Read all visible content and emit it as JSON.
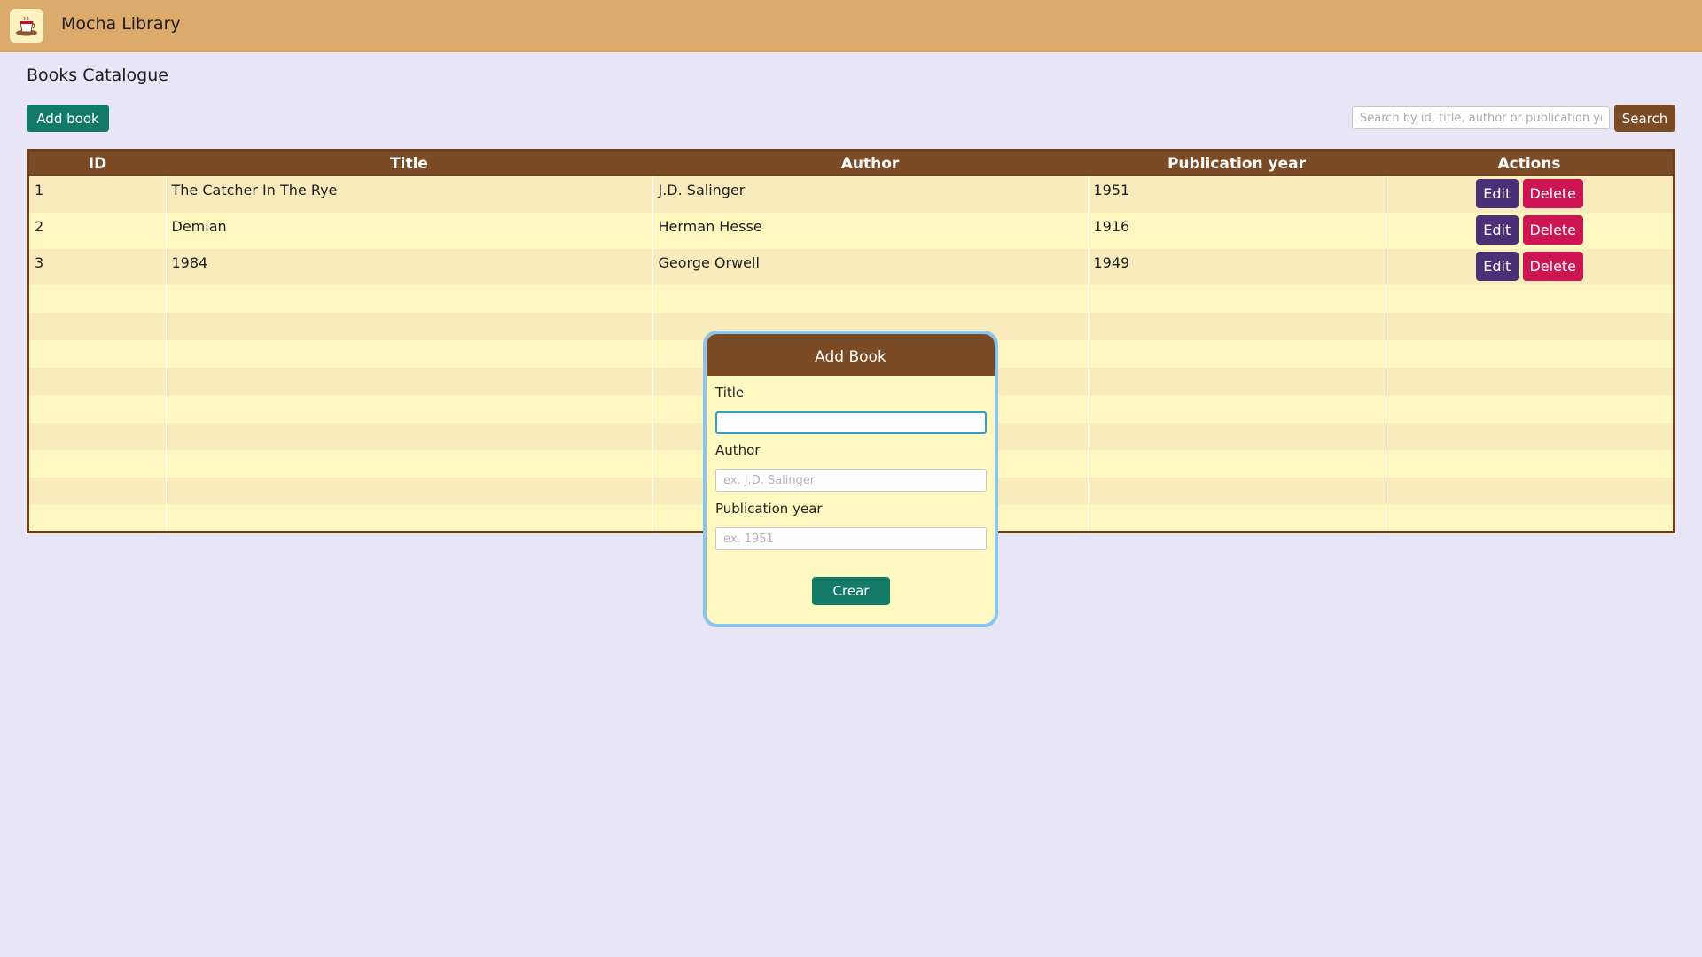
{
  "app": {
    "title": "Mocha Library",
    "logo_icon": "coffee-cup-icon"
  },
  "page": {
    "title": "Books Catalogue",
    "add_label": "Add book"
  },
  "search": {
    "placeholder": "Search by id, title, author or publication year...",
    "value": "",
    "button_label": "Search"
  },
  "table": {
    "headers": [
      "ID",
      "Title",
      "Author",
      "Publication year",
      "Actions"
    ],
    "rows": [
      {
        "id": "1",
        "title": "The Catcher In The Rye",
        "author": "J.D. Salinger",
        "year": "1951"
      },
      {
        "id": "2",
        "title": "Demian",
        "author": "Herman Hesse",
        "year": "1916"
      },
      {
        "id": "3",
        "title": "1984",
        "author": "George Orwell",
        "year": "1949"
      }
    ],
    "edit_label": "Edit",
    "delete_label": "Delete"
  },
  "modal": {
    "title": "Add Book",
    "fields": {
      "title_label": "Title",
      "title_value": "",
      "author_label": "Author",
      "author_placeholder": "ex. J.D. Salinger",
      "year_label": "Publication year",
      "year_placeholder": "ex. 1951"
    },
    "submit_label": "Crear"
  },
  "colors": {
    "topbar": "#dcaa6a",
    "background": "#e8e6f6",
    "header_brown": "#7a4b24",
    "primary_green": "#137a68",
    "edit_purple": "#4a3177",
    "delete_red": "#cc1552",
    "row_odd": "#faebbc",
    "row_even": "#fef8c0",
    "modal_border": "#8bc4ec"
  }
}
